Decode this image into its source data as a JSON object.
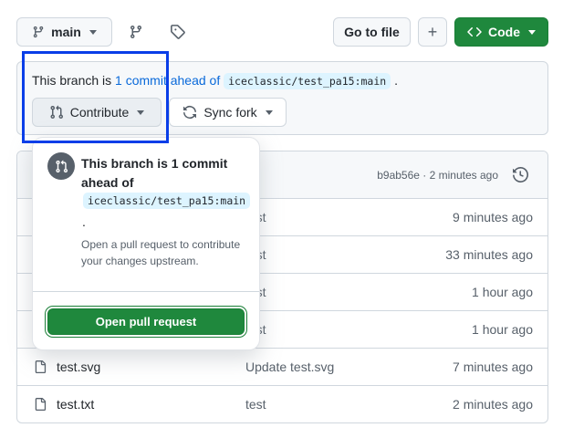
{
  "toolbar": {
    "branch_label": "main",
    "branches_icon": "git-branch-icon",
    "tags_icon": "tag-icon",
    "go_to_file_label": "Go to file",
    "add_file_label": "+",
    "code_label": "Code"
  },
  "ahead_banner": {
    "prefix": "This branch is",
    "commits_link": "1 commit ahead of",
    "upstream": "iceclassic/test_pa15:main",
    "suffix": ".",
    "contribute_label": "Contribute",
    "sync_fork_label": "Sync fork"
  },
  "popover": {
    "title": "This branch is 1 commit ahead of",
    "upstream": "iceclassic/test_pa15:main",
    "period": ".",
    "description": "Open a pull request to contribute your changes upstream.",
    "open_pr_label": "Open pull request"
  },
  "file_table": {
    "latest_commit": "b9ab56e · 2 minutes ago",
    "rows": [
      {
        "name": "",
        "message": "test",
        "time": "9 minutes ago"
      },
      {
        "name": "",
        "message": "test",
        "time": "33 minutes ago"
      },
      {
        "name": "",
        "message": "test",
        "time": "1 hour ago"
      },
      {
        "name": "",
        "message": "test",
        "time": "1 hour ago"
      },
      {
        "name": "test.svg",
        "message": "Update test.svg",
        "time": "7 minutes ago"
      },
      {
        "name": "test.txt",
        "message": "test",
        "time": "2 minutes ago"
      }
    ]
  },
  "colors": {
    "primary_green": "#1f883d",
    "link_blue": "#0969da",
    "highlight_blue": "#0a3ee8"
  }
}
